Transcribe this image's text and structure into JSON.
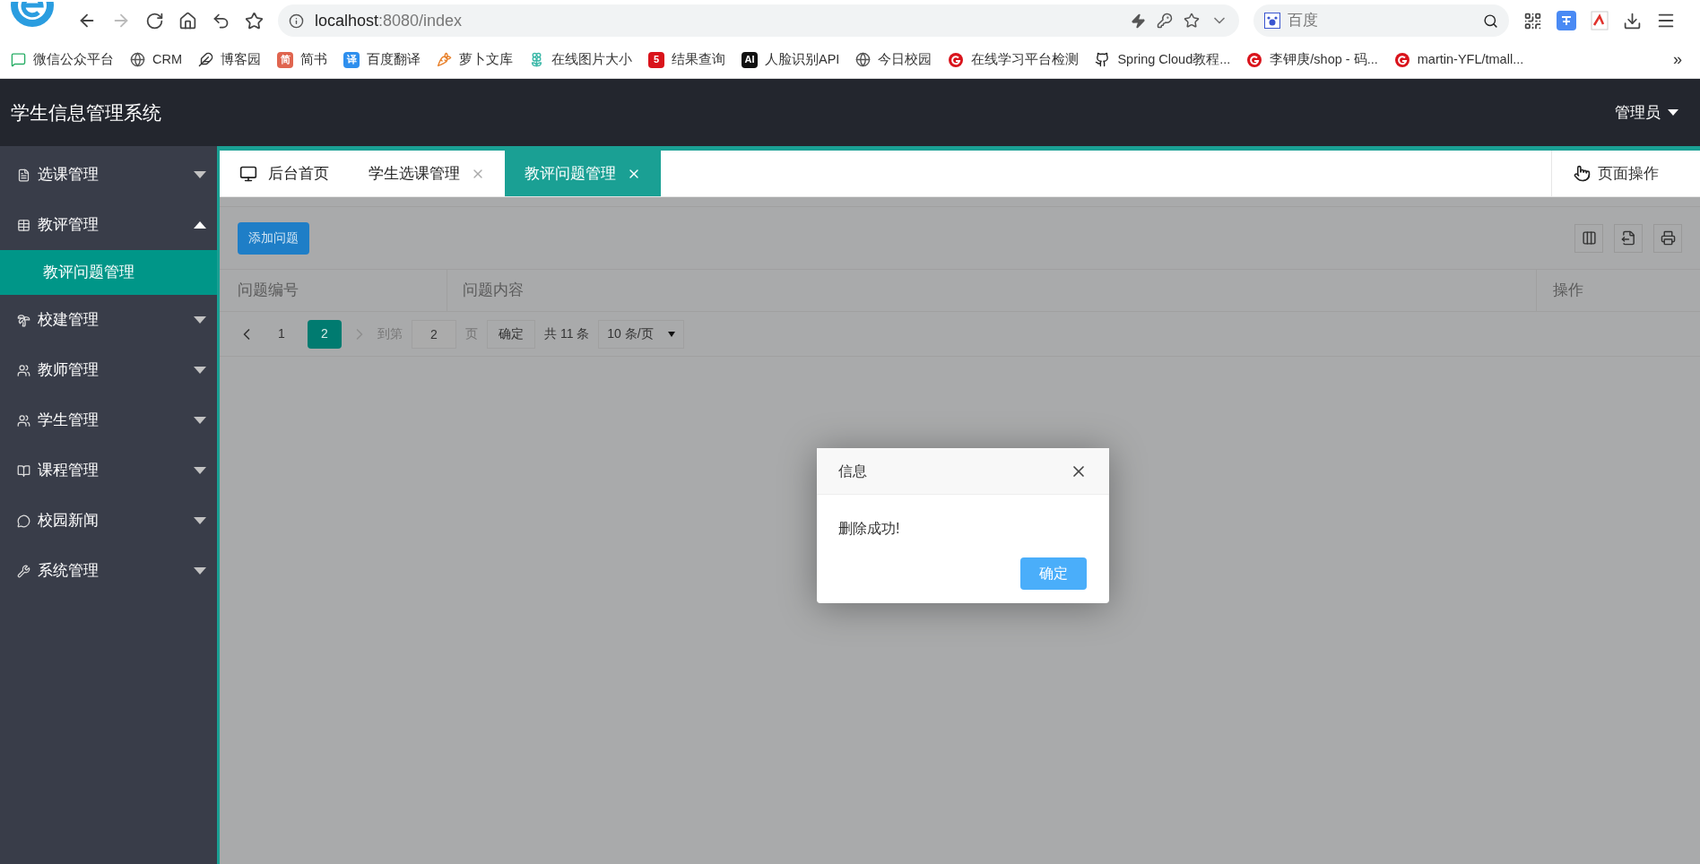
{
  "browser": {
    "url_host": "localhost",
    "url_rest": ":8080/index",
    "search_placeholder": "百度",
    "bookmarks": [
      {
        "label": "微信公众平台"
      },
      {
        "label": "CRM"
      },
      {
        "label": "博客园"
      },
      {
        "label": "简书",
        "badge": "简",
        "color": "#e0654f"
      },
      {
        "label": "百度翻译",
        "badge": "译",
        "color": "#2e8fee"
      },
      {
        "label": "萝卜文库"
      },
      {
        "label": "在线图片大小"
      },
      {
        "label": "结果查询",
        "badge": "5",
        "color": "#d9131b"
      },
      {
        "label": "人脸识别API",
        "badge": "AI",
        "color": "#111111"
      },
      {
        "label": "今日校园"
      },
      {
        "label": "在线学习平台检测"
      },
      {
        "label": "Spring Cloud教程..."
      },
      {
        "label": "李钾庚/shop - 码..."
      },
      {
        "label": "martin-YFL/tmall..."
      }
    ],
    "more": "»"
  },
  "app": {
    "title": "学生信息管理系统",
    "user": "管理员"
  },
  "sidebar": {
    "items": [
      {
        "label": "选课管理",
        "expanded": false
      },
      {
        "label": "教评管理",
        "expanded": true,
        "children": [
          {
            "label": "教评问题管理",
            "selected": true
          }
        ]
      },
      {
        "label": "校建管理",
        "expanded": false
      },
      {
        "label": "教师管理",
        "expanded": false
      },
      {
        "label": "学生管理",
        "expanded": false
      },
      {
        "label": "课程管理",
        "expanded": false
      },
      {
        "label": "校园新闻",
        "expanded": false
      },
      {
        "label": "系统管理",
        "expanded": false
      }
    ]
  },
  "tabs": [
    {
      "label": "后台首页",
      "closable": false,
      "selected": false
    },
    {
      "label": "学生选课管理",
      "closable": true,
      "selected": false
    },
    {
      "label": "教评问题管理",
      "closable": true,
      "selected": true
    }
  ],
  "page_actions": "页面操作",
  "toolbar": {
    "add_button": "添加问题"
  },
  "table": {
    "columns": [
      "问题编号",
      "问题内容",
      "操作"
    ]
  },
  "pagination": {
    "pages": [
      {
        "label": "1",
        "selected": false
      },
      {
        "label": "2",
        "selected": true
      }
    ],
    "goto_label": "到第",
    "page_input": "2",
    "page_unit": "页",
    "confirm": "确定",
    "total": "共 11 条",
    "page_size": "10 条/页"
  },
  "dialog": {
    "title": "信息",
    "message": "删除成功!",
    "ok": "确定"
  }
}
